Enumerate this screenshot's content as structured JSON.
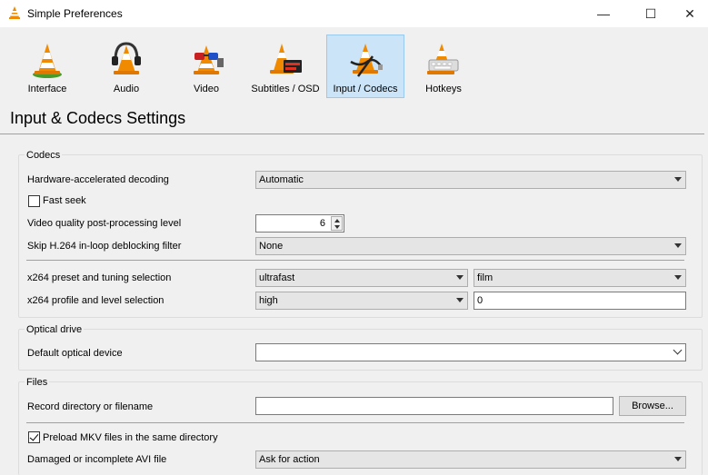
{
  "window": {
    "title": "Simple Preferences",
    "controls": {
      "minimize": "—",
      "maximize": "☐",
      "close": "✕"
    }
  },
  "toolbar": {
    "items": [
      {
        "label": "Interface",
        "icon": "cone-interface-icon",
        "active": false
      },
      {
        "label": "Audio",
        "icon": "cone-headphones-icon",
        "active": false
      },
      {
        "label": "Video",
        "icon": "cone-glasses-icon",
        "active": false
      },
      {
        "label": "Subtitles / OSD",
        "icon": "cone-display-icon",
        "active": false
      },
      {
        "label": "Input / Codecs",
        "icon": "cone-cables-icon",
        "active": true
      },
      {
        "label": "Hotkeys",
        "icon": "cone-keyboard-icon",
        "active": false
      }
    ]
  },
  "page": {
    "heading": "Input & Codecs Settings"
  },
  "codecs": {
    "title": "Codecs",
    "hw_decoding": {
      "label": "Hardware-accelerated decoding",
      "value": "Automatic"
    },
    "fast_seek": {
      "label": "Fast seek",
      "checked": false
    },
    "post_processing": {
      "label": "Video quality post-processing level",
      "value": "6"
    },
    "skip_h264": {
      "label": "Skip H.264 in-loop deblocking filter",
      "value": "None"
    },
    "x264_preset": {
      "label": "x264 preset and tuning selection",
      "preset": "ultrafast",
      "tuning": "film"
    },
    "x264_profile": {
      "label": "x264 profile and level selection",
      "profile": "high",
      "level": "0"
    }
  },
  "optical": {
    "title": "Optical drive",
    "device": {
      "label": "Default optical device",
      "value": ""
    }
  },
  "files": {
    "title": "Files",
    "record": {
      "label": "Record directory or filename",
      "value": "",
      "browse": "Browse..."
    },
    "preload_mkv": {
      "label": "Preload MKV files in the same directory",
      "checked": true
    },
    "avi": {
      "label": "Damaged or incomplete AVI file",
      "value": "Ask for action"
    }
  },
  "colors": {
    "active_tab_bg": "#cce4f7",
    "active_tab_border": "#99c9ef",
    "cone_orange": "#f08a00"
  }
}
